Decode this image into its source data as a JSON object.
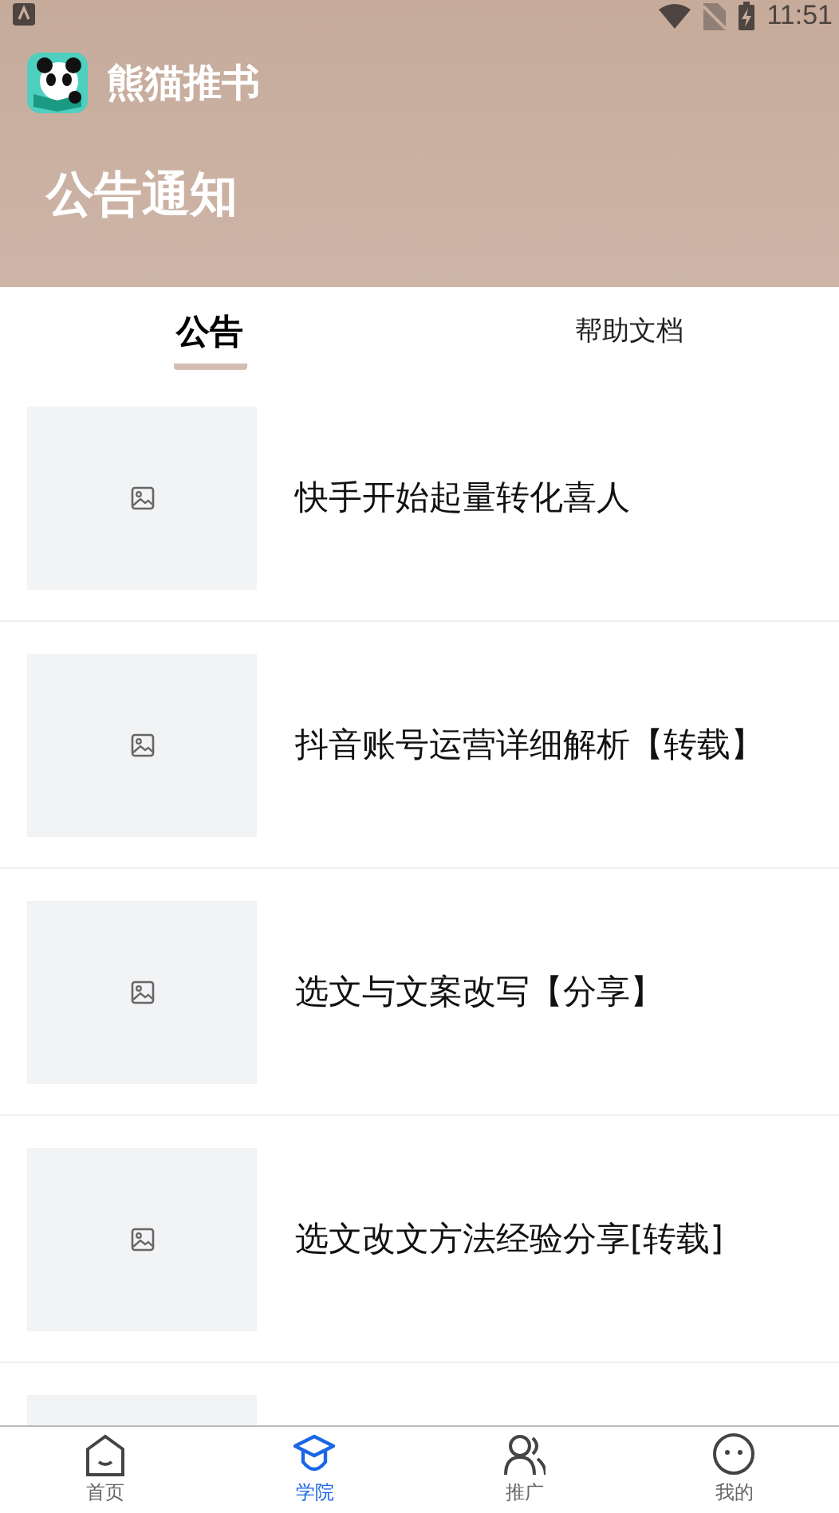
{
  "status_bar": {
    "time": "11:51"
  },
  "app": {
    "name": "熊猫推书"
  },
  "header": {
    "title": "公告通知"
  },
  "tabs": [
    {
      "label": "公告",
      "selected": true
    },
    {
      "label": "帮助文档",
      "selected": false
    }
  ],
  "articles": [
    {
      "title": "快手开始起量转化喜人"
    },
    {
      "title": "抖音账号运营详细解析【转载】"
    },
    {
      "title": "选文与文案改写【分享】"
    },
    {
      "title": "选文改文方法经验分享[转载]"
    },
    {
      "thumbnail": {
        "kind": "partial"
      }
    }
  ],
  "bottom_nav": [
    {
      "label": "首页",
      "selected": false
    },
    {
      "label": "学院",
      "selected": true
    },
    {
      "label": "推广",
      "selected": false
    },
    {
      "label": "我的",
      "selected": false
    }
  ]
}
